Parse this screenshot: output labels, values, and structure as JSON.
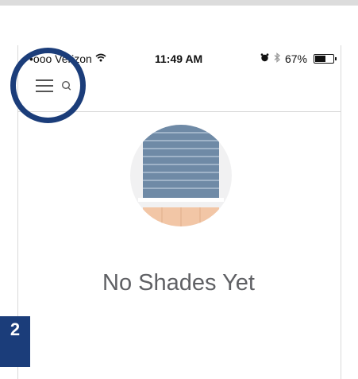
{
  "status_bar": {
    "carrier": "•ooo Verizon",
    "time": "11:49 AM",
    "battery": "67%",
    "battery_level": 0.67
  },
  "icons": {
    "wifi": "wifi-icon",
    "alarm": "alarm-icon",
    "bluetooth": "bluetooth-icon",
    "battery": "battery-icon",
    "menu": "hamburger-menu-icon",
    "search": "search-icon",
    "empty_illustration": "window-shade-icon"
  },
  "empty_state": {
    "title": "No Shades Yet"
  },
  "page_badge": "2",
  "colors": {
    "highlight": "#1b3d7a",
    "shade": "#6f8aa6",
    "sill": "#f2c6a6",
    "title_text": "#5f6064"
  }
}
